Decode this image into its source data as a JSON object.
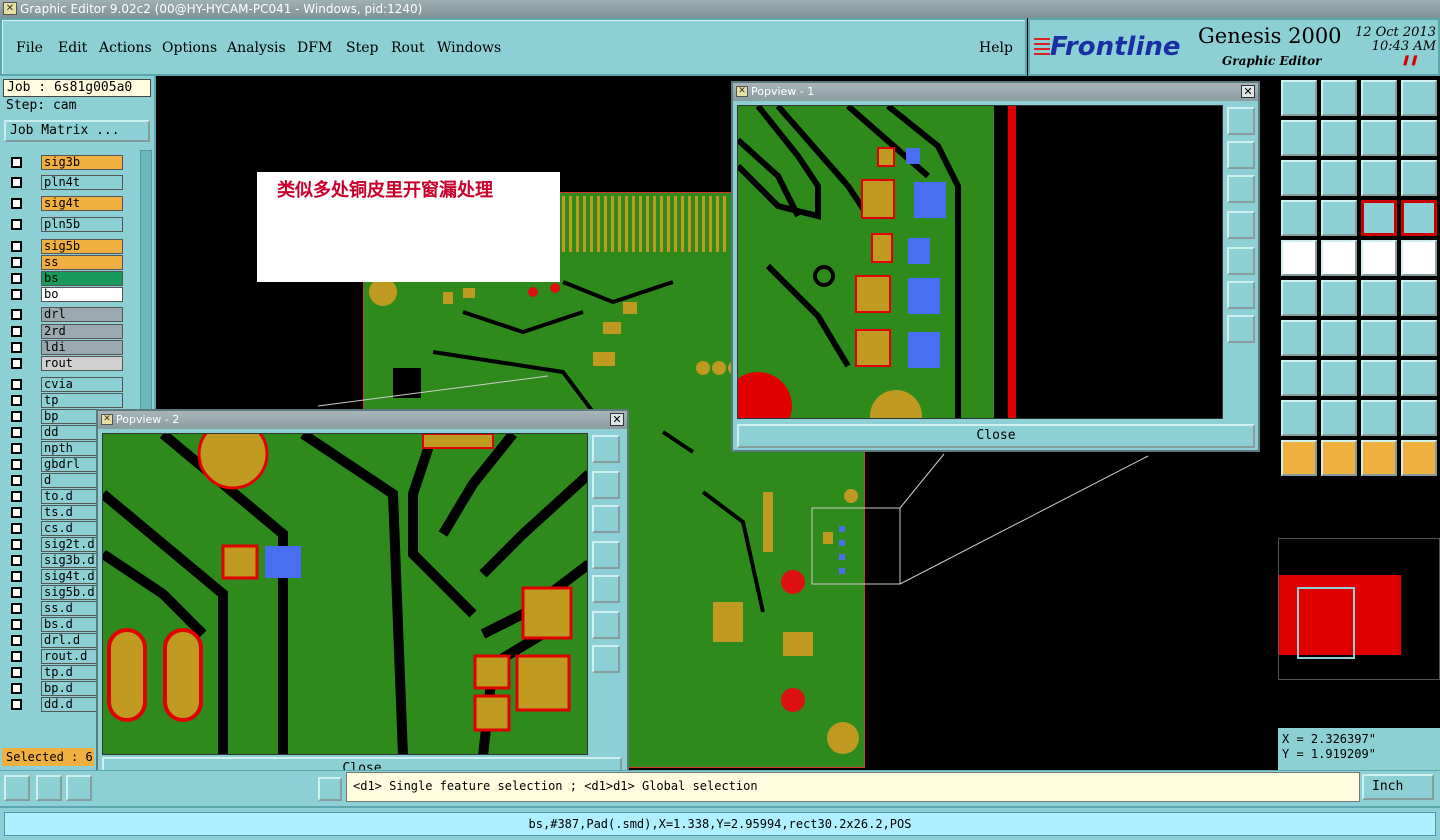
{
  "window": {
    "title": "Graphic Editor 9.02c2 (00@HY-HYCAM-PC041 - Windows, pid:1240)"
  },
  "menu": [
    "File",
    "Edit",
    "Actions",
    "Options",
    "Analysis",
    "DFM",
    "Step",
    "Rout",
    "Windows"
  ],
  "help_label": "Help",
  "brand": {
    "logo": "Frontline",
    "product": "Genesis 2000",
    "subtitle": "Graphic Editor",
    "date": "12 Oct 2013",
    "time": "10:43 AM"
  },
  "job": {
    "label": "Job : 6s81g005a0",
    "step": "Step: cam",
    "matrix_button": "Job Matrix ..."
  },
  "layers": [
    {
      "name": "sig3b",
      "color": "#f0b040"
    },
    {
      "name": "pln4t",
      "color": "#8ccfd4"
    },
    {
      "name": "sig4t",
      "color": "#f0b040"
    },
    {
      "name": "pln5b",
      "color": "#8ccfd4"
    },
    {
      "name": "sig5b",
      "color": "#f0b040"
    },
    {
      "name": "ss",
      "color": "#f0b040"
    },
    {
      "name": "bs",
      "color": "#1a9a5a"
    },
    {
      "name": "bo",
      "color": "#ffffff"
    },
    {
      "name": "drl",
      "color": "#9aa8b0"
    },
    {
      "name": "2rd",
      "color": "#9aa8b0"
    },
    {
      "name": "ldi",
      "color": "#9aa8b0"
    },
    {
      "name": "rout",
      "color": "#d0d0d0"
    },
    {
      "name": "cvia",
      "color": "#8ccfd4"
    },
    {
      "name": "tp",
      "color": "#8ccfd4"
    },
    {
      "name": "bp",
      "color": "#8ccfd4"
    },
    {
      "name": "dd",
      "color": "#8ccfd4"
    },
    {
      "name": "npth",
      "color": "#8ccfd4"
    },
    {
      "name": "gbdrl",
      "color": "#8ccfd4"
    },
    {
      "name": "d",
      "color": "#8ccfd4"
    },
    {
      "name": "to.d",
      "color": "#8ccfd4"
    },
    {
      "name": "ts.d",
      "color": "#8ccfd4"
    },
    {
      "name": "cs.d",
      "color": "#8ccfd4"
    },
    {
      "name": "sig2t.d",
      "color": "#8ccfd4"
    },
    {
      "name": "sig3b.d",
      "color": "#8ccfd4"
    },
    {
      "name": "sig4t.d",
      "color": "#8ccfd4"
    },
    {
      "name": "sig5b.d",
      "color": "#8ccfd4"
    },
    {
      "name": "ss.d",
      "color": "#8ccfd4"
    },
    {
      "name": "bs.d",
      "color": "#8ccfd4"
    },
    {
      "name": "drl.d",
      "color": "#8ccfd4"
    },
    {
      "name": "rout.d",
      "color": "#8ccfd4"
    },
    {
      "name": "tp.d",
      "color": "#8ccfd4"
    },
    {
      "name": "bp.d",
      "color": "#8ccfd4"
    },
    {
      "name": "dd.d",
      "color": "#8ccfd4"
    }
  ],
  "selected": "Selected : 6",
  "note": "类似多处铜皮里开窗漏处理",
  "popview1": {
    "title": "Popview - 1",
    "close": "Close"
  },
  "popview2": {
    "title": "Popview - 2",
    "close": "Close"
  },
  "coords": {
    "x": "X = 2.326397\"",
    "y": "Y = 1.919209\""
  },
  "message": "<d1> Single feature selection ; <d1>d1> Global selection",
  "units": "Inch",
  "status": "bs,#387,Pad(.smd),X=1.338,Y=2.95994,rect30.2x26.2,POS",
  "colors": {
    "copper": "#2e8a1a",
    "pad": "#c09a20",
    "highlight": "#4a6ef0",
    "outline": "#e00000"
  }
}
